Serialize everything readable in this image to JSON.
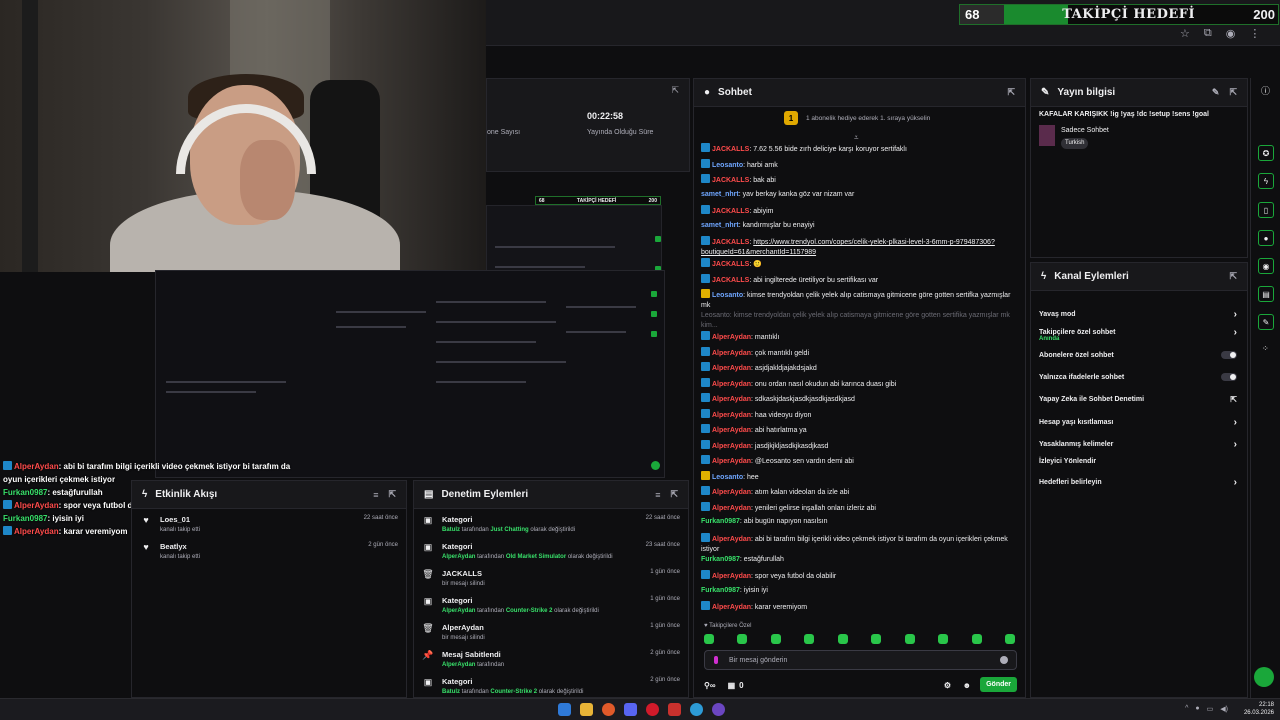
{
  "goal": {
    "current": "68",
    "label": "TAKİPÇİ HEDEFİ",
    "target": "200",
    "progress_fraction": 0.34
  },
  "preview_goal": {
    "current": "68",
    "label": "TAKİPÇİ HEDEFİ",
    "target": "200"
  },
  "stats": {
    "time": "00:22:58",
    "time_label": "Yayında Olduğu Süre",
    "viewer_label": "one Sayısı"
  },
  "overlay_chat": [
    {
      "user": "AlperAydan",
      "color": "u-r",
      "badge": "b",
      "text": ": abi bi tarafım bilgi içerikli video çekmek istiyor bi tarafım da oyun içerikleri çekmek istiyor"
    },
    {
      "user": "Furkan0987",
      "color": "u-g",
      "badge": "",
      "text": ": estağfurullah"
    },
    {
      "user": "AlperAydan",
      "color": "u-r",
      "badge": "b",
      "text": ": spor veya futbol da olabilir"
    },
    {
      "user": "Furkan0987",
      "color": "u-g",
      "badge": "",
      "text": ": iyisin iyi"
    },
    {
      "user": "AlperAydan",
      "color": "u-r",
      "badge": "b",
      "text": ": karar veremiyom"
    }
  ],
  "activity": {
    "title": "Etkinlik Akışı",
    "items": [
      {
        "name": "Loes_01",
        "desc": "kanalı takip etti",
        "when": "22 saat önce"
      },
      {
        "name": "Beatlyx",
        "desc": "kanalı takip etti",
        "when": "2 gün önce"
      }
    ]
  },
  "modlog": {
    "title": "Denetim Eylemleri",
    "items": [
      {
        "icon": "▣",
        "head": "Kategori",
        "u": "Batulz",
        "mid": " tarafından ",
        "g": "Just Chatting",
        "tail": " olarak değiştirildi",
        "when": "22 saat önce"
      },
      {
        "icon": "▣",
        "head": "Kategori",
        "u": "AlperAydan",
        "mid": " tarafından ",
        "g": "Old Market Simulator",
        "tail": " olarak değiştirildi",
        "when": "23 saat önce"
      },
      {
        "icon": "🗑",
        "head": "JACKALLS",
        "u": "",
        "mid": "bir mesajı silindi",
        "g": "",
        "tail": "",
        "when": "1 gün önce"
      },
      {
        "icon": "▣",
        "head": "Kategori",
        "u": "AlperAydan",
        "mid": " tarafından ",
        "g": "Counter-Strike 2",
        "tail": " olarak değiştirildi",
        "when": "1 gün önce"
      },
      {
        "icon": "🗑",
        "head": "AlperAydan",
        "u": "",
        "mid": "bir mesajı silindi",
        "g": "",
        "tail": "",
        "when": "1 gün önce"
      },
      {
        "icon": "📌",
        "head": "Mesaj Sabitlendi",
        "u": "AlperAydan",
        "mid": " tarafından",
        "g": "",
        "tail": "",
        "when": "2 gün önce"
      },
      {
        "icon": "▣",
        "head": "Kategori",
        "u": "Batulz",
        "mid": " tarafından ",
        "g": "Counter-Strike 2",
        "tail": " olarak değiştirildi",
        "when": "2 gün önce"
      }
    ]
  },
  "chat": {
    "title": "Sohbet",
    "pinned": "1 abonelik hediye ederek 1. sıraya yükselin",
    "messages": [
      {
        "user": "JACKALLS",
        "color": "u-r",
        "badge": "b",
        "text": ": 7.62 5.56 bide zırh deliciye karşı koruyor sertifaklı"
      },
      {
        "user": "Leosanto",
        "color": "u-b",
        "badge": "b",
        "text": ": harbi amk"
      },
      {
        "user": "JACKALLS",
        "color": "u-r",
        "badge": "b",
        "text": ": bak abi"
      },
      {
        "user": "samet_nhrt",
        "color": "u-b",
        "badge": "",
        "text": ": yav berkay kanka göz var nizam var"
      },
      {
        "user": "JACKALLS",
        "color": "u-r",
        "badge": "b",
        "text": ": abiyim"
      },
      {
        "user": "samet_nhrt",
        "color": "u-b",
        "badge": "",
        "text": ": kandırmışlar bu enayiyi"
      },
      {
        "user": "JACKALLS",
        "color": "u-r",
        "badge": "b",
        "text": ": ",
        "link": "https://www.trendyol.com/copes/celik-yelek-plkasi-level-3-6mm-p-979487306?boutiqueId=61&merchantId=1157989"
      },
      {
        "user": "JACKALLS",
        "color": "u-r",
        "badge": "b",
        "text": ": 🙂"
      },
      {
        "user": "JACKALLS",
        "color": "u-r",
        "badge": "b",
        "text": ": abi ingilterede üretiliyor bu sertifikası var"
      },
      {
        "user": "Leosanto",
        "color": "u-b",
        "badge": "y",
        "text": ": kimse trendyoldan çelik yelek alıp catismaya gitmicene göre gotten sertifka yazmışlar mk"
      },
      {
        "user": "",
        "color": "",
        "badge": "",
        "dim": true,
        "text": "Leosanto: kimse trendyoldan çelik yelek alıp catismaya gitmicene göre gotten sertifika yazmışlar mk kim..."
      },
      {
        "user": "AlperAydan",
        "color": "u-r",
        "badge": "b",
        "text": ": mantıklı"
      },
      {
        "user": "AlperAydan",
        "color": "u-r",
        "badge": "b",
        "text": ": çok mantıklı geldi"
      },
      {
        "user": "AlperAydan",
        "color": "u-r",
        "badge": "b",
        "text": ": asjdjakldjajakdsjakd"
      },
      {
        "user": "AlperAydan",
        "color": "u-r",
        "badge": "b",
        "text": ": onu ordan nasıl okudun abi karınca duası gibi"
      },
      {
        "user": "AlperAydan",
        "color": "u-r",
        "badge": "b",
        "text": ": sdkaskjdaskjasdkjasdkjasdkjasd"
      },
      {
        "user": "AlperAydan",
        "color": "u-r",
        "badge": "b",
        "text": ": haa videoyu diyon"
      },
      {
        "user": "AlperAydan",
        "color": "u-r",
        "badge": "b",
        "text": ": abi hatırlatma ya"
      },
      {
        "user": "AlperAydan",
        "color": "u-r",
        "badge": "b",
        "text": ": jasdjkjkljasdkjkasdjkasd"
      },
      {
        "user": "AlperAydan",
        "color": "u-r",
        "badge": "b",
        "text": ": @Leosanto sen vardın demi abi"
      },
      {
        "user": "Leosanto",
        "color": "u-b",
        "badge": "y",
        "text": ": hee"
      },
      {
        "user": "AlperAydan",
        "color": "u-r",
        "badge": "b",
        "text": ": atım kalan videoları da izle abi"
      },
      {
        "user": "AlperAydan",
        "color": "u-r",
        "badge": "b",
        "text": ": yenileri gelirse inşallah onları izleriz abi"
      },
      {
        "user": "Furkan0987",
        "color": "u-g",
        "badge": "",
        "text": ": abi bugün napıyon nasılsın"
      },
      {
        "user": "AlperAydan",
        "color": "u-r",
        "badge": "b",
        "text": ": abi bi tarafım bilgi içerikli video çekmek istiyor bi tarafım da oyun içerikleri çekmek istiyor"
      },
      {
        "user": "Furkan0987",
        "color": "u-g",
        "badge": "",
        "text": ": estağfurullah"
      },
      {
        "user": "AlperAydan",
        "color": "u-r",
        "badge": "b",
        "text": ": spor veya futbol da olabilir"
      },
      {
        "user": "Furkan0987",
        "color": "u-g",
        "badge": "",
        "text": ": iyisin iyi"
      },
      {
        "user": "AlperAydan",
        "color": "u-r",
        "badge": "b",
        "text": ": karar veremiyom"
      }
    ],
    "followers_only": "Takipçilere Özel",
    "input_placeholder": "Bir mesaj gönderin",
    "points": "0",
    "send_label": "Gönder"
  },
  "stream_info": {
    "title": "Yayın bilgisi",
    "stream_title": "KAFALAR KARIŞIKK !ig !yaş !dc !setup !sens !goal",
    "category": "Sadece Sohbet",
    "language": "Turkish"
  },
  "channel_actions": {
    "title": "Kanal Eylemleri",
    "items": [
      {
        "label": "Yavaş mod",
        "kind": "chev",
        "sub": ""
      },
      {
        "label": "Takipçilere özel sohbet",
        "kind": "chev",
        "sub": "Anında"
      },
      {
        "label": "Abonelere özel sohbet",
        "kind": "toggle",
        "sub": ""
      },
      {
        "label": "Yalnızca ifadelerle sohbet",
        "kind": "toggle",
        "sub": ""
      },
      {
        "label": "Yapay Zeka ile Sohbet Denetimi",
        "kind": "ext",
        "sub": ""
      },
      {
        "label": "Hesap yaşı kısıtlaması",
        "kind": "chev",
        "sub": ""
      },
      {
        "label": "Yasaklanmış kelimeler",
        "kind": "chev",
        "sub": ""
      },
      {
        "label": "İzleyici Yönlendir",
        "kind": "none",
        "sub": ""
      },
      {
        "label": "Hedefleri belirleyin",
        "kind": "chev",
        "sub": ""
      }
    ]
  },
  "taskbar": {
    "time": "22:18",
    "date": "26.03.2026"
  },
  "colors": {
    "accent": "#1aa73a",
    "username_red": "#ff4b4b",
    "username_green": "#38e06a",
    "username_blue": "#6fa6ff"
  }
}
